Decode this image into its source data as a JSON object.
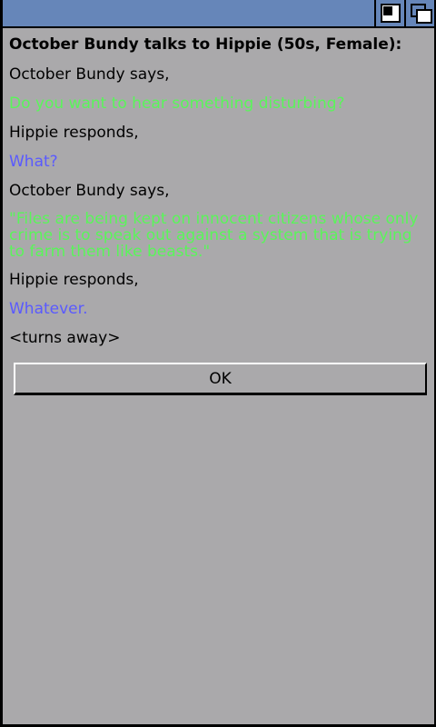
{
  "window": {
    "zoom_icon": "zoom-gadget-icon",
    "depth_icon": "depth-gadget-icon"
  },
  "dialog": {
    "heading": "October Bundy talks to Hippie (50s, Female):",
    "lines": [
      {
        "text": "October Bundy says,",
        "color": "#000000"
      },
      {
        "text": "Do you want to hear something disturbing?",
        "color": "#5af55a"
      },
      {
        "text": "Hippie responds,",
        "color": "#000000"
      },
      {
        "text": "What?",
        "color": "#5a5aff"
      },
      {
        "text": "October Bundy says,",
        "color": "#000000"
      },
      {
        "text": "\"Files are being kept on innocent citizens whose only crime is to speak out against a system that is trying to farm them like beasts.\"",
        "color": "#5af55a"
      },
      {
        "text": "Hippie responds,",
        "color": "#000000"
      },
      {
        "text": "Whatever.",
        "color": "#5a5aff"
      },
      {
        "text": "<turns away>",
        "color": "#000000"
      }
    ],
    "ok_label": "OK"
  },
  "colors": {
    "background": "#aaa9ab",
    "titlebar": "#6686b9",
    "speech_green": "#5af55a",
    "speech_blue": "#5a5aff"
  }
}
